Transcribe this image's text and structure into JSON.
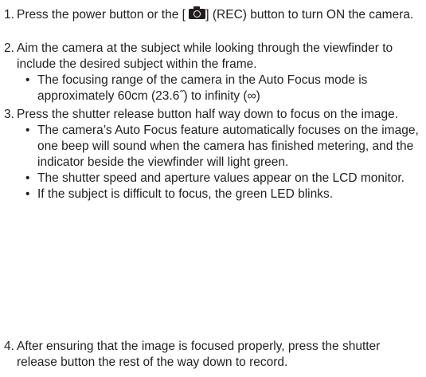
{
  "steps": [
    {
      "number": "1.",
      "text_before_icon": "Press the power button or the [ ",
      "icon": "camera-icon",
      "text_after_icon": "] (REC) button to turn ON the camera."
    },
    {
      "number": "2.",
      "text": "Aim the camera at the subject while looking through the viewfinder to include the desired subject within the frame.",
      "bullets": [
        "The focusing range of the camera in the Auto Focus mode is approximately 60cm (23.6˝) to infinity (∞)"
      ]
    },
    {
      "number": "3.",
      "text": "Press the shutter release button half way down to focus on the image.",
      "bullets": [
        "The camera’s Auto Focus feature automatically focuses on the image, one beep will sound when the camera has finished metering, and the indicator beside the viewfinder will light green.",
        "The shutter speed and aperture values appear on the LCD monitor.",
        "If the subject is difficult to focus, the green LED blinks."
      ]
    },
    {
      "number": "4.",
      "text": "After ensuring that the image is focused properly, press the shutter release button the rest of the way down to record."
    }
  ],
  "bullet_char": "•"
}
